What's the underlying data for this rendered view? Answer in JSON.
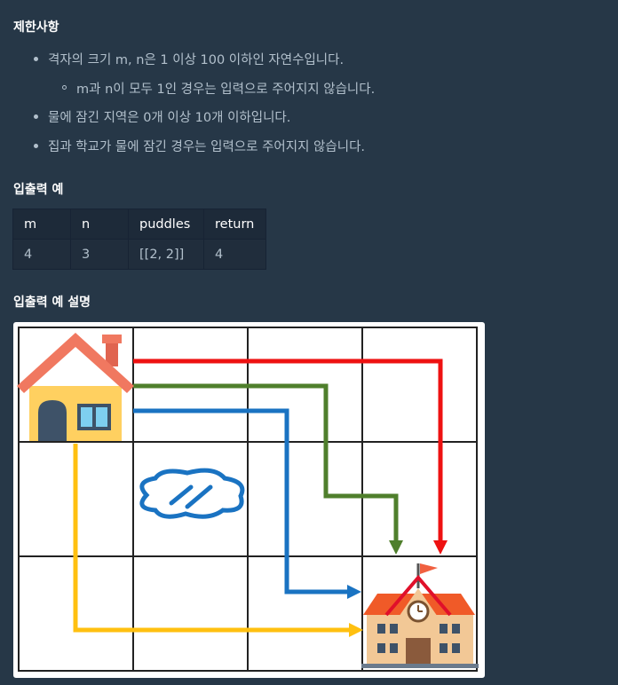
{
  "constraints": {
    "heading": "제한사항",
    "items": [
      "격자의 크기 m, n은 1 이상 100 이하인 자연수입니다.",
      "m과 n이 모두 1인 경우는 입력으로 주어지지 않습니다.",
      "물에 잠긴 지역은 0개 이상 10개 이하입니다.",
      "집과 학교가 물에 잠긴 경우는 입력으로 주어지지 않습니다."
    ]
  },
  "examples": {
    "heading": "입출력 예",
    "columns": [
      "m",
      "n",
      "puddles",
      "return"
    ],
    "rows": [
      [
        "4",
        "3",
        "[[2, 2]]",
        "4"
      ]
    ]
  },
  "explanation": {
    "heading": "입출력 예 설명"
  },
  "colors": {
    "background": "#263747",
    "route_red": "#ee1111",
    "route_green": "#4f7f2c",
    "route_blue": "#1a73c2",
    "route_yellow": "#ffc010",
    "puddle": "#1a73c2"
  }
}
